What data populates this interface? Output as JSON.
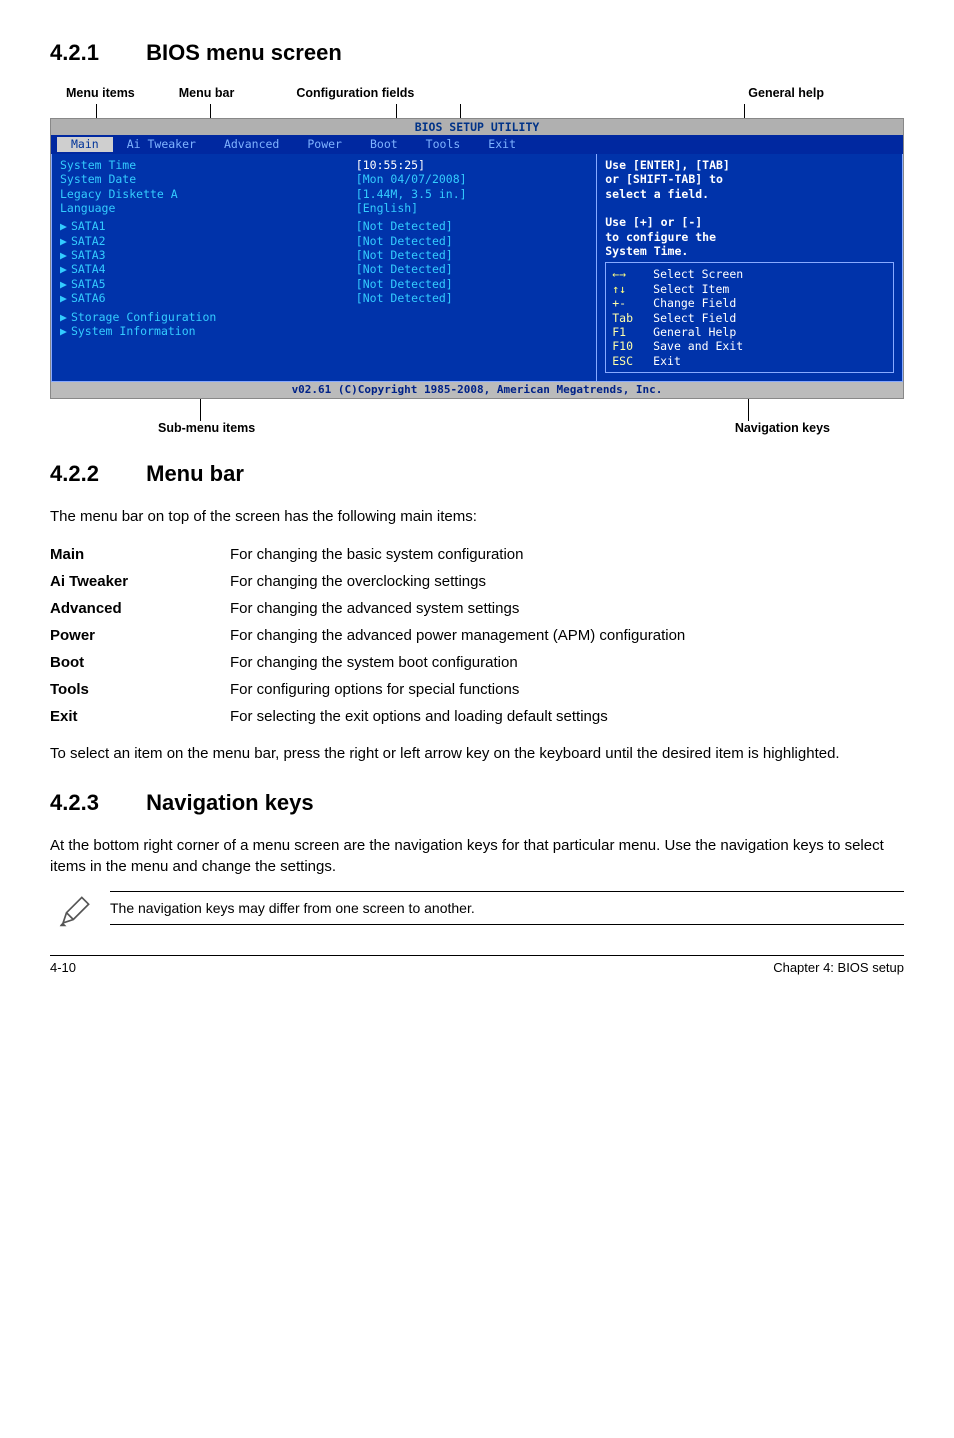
{
  "sections": {
    "s1": {
      "num": "4.2.1",
      "title": "BIOS menu screen"
    },
    "s2": {
      "num": "4.2.2",
      "title": "Menu bar"
    },
    "s3": {
      "num": "4.2.3",
      "title": "Navigation keys"
    }
  },
  "top_labels": {
    "menu_items": "Menu items",
    "menu_bar": "Menu bar",
    "config_fields": "Configuration fields",
    "general_help": "General help"
  },
  "bottom_labels": {
    "sub_menu": "Sub-menu items",
    "nav_keys": "Navigation keys"
  },
  "bios": {
    "title": "BIOS SETUP UTILITY",
    "tabs": [
      "Main",
      "Ai Tweaker",
      "Advanced",
      "Power",
      "Boot",
      "Tools",
      "Exit"
    ],
    "left": [
      {
        "k": "System Time",
        "v": "[10:55:25]",
        "sel": true
      },
      {
        "k": "System Date",
        "v": "[Mon 04/07/2008]"
      },
      {
        "k": "Legacy Diskette A",
        "v": "[1.44M, 3.5 in.]"
      },
      {
        "k": "Language",
        "v": "[English]"
      }
    ],
    "sata": [
      {
        "k": "SATA1",
        "v": "[Not Detected]"
      },
      {
        "k": "SATA2",
        "v": "[Not Detected]"
      },
      {
        "k": "SATA3",
        "v": "[Not Detected]"
      },
      {
        "k": "SATA4",
        "v": "[Not Detected]"
      },
      {
        "k": "SATA5",
        "v": "[Not Detected]"
      },
      {
        "k": "SATA6",
        "v": "[Not Detected]"
      }
    ],
    "submenu": [
      "Storage Configuration",
      "System Information"
    ],
    "help": "Use [ENTER], [TAB]\nor [SHIFT-TAB] to\nselect a field.\n\nUse [+] or [-]\nto configure the\nSystem Time.",
    "nav": [
      {
        "key": "←→",
        "txt": "Select Screen"
      },
      {
        "key": "↑↓",
        "txt": "Select Item"
      },
      {
        "key": "+-",
        "txt": "Change Field"
      },
      {
        "key": "Tab",
        "txt": "Select Field"
      },
      {
        "key": "F1",
        "txt": "General Help"
      },
      {
        "key": "F10",
        "txt": "Save and Exit"
      },
      {
        "key": "ESC",
        "txt": "Exit"
      }
    ],
    "footer": "v02.61 (C)Copyright 1985-2008, American Megatrends, Inc."
  },
  "menubar_intro": "The menu bar on top of the screen has the following main items:",
  "defs": [
    {
      "k": "Main",
      "v": "For changing the basic system configuration"
    },
    {
      "k": "Ai Tweaker",
      "v": "For changing the overclocking settings"
    },
    {
      "k": "Advanced",
      "v": "For changing the advanced system settings"
    },
    {
      "k": "Power",
      "v": "For changing the advanced power management (APM) configuration"
    },
    {
      "k": "Boot",
      "v": "For changing the system boot configuration"
    },
    {
      "k": "Tools",
      "v": "For configuring options for special functions"
    },
    {
      "k": "Exit",
      "v": "For selecting the exit options and loading default settings"
    }
  ],
  "menubar_outro": "To select an item on the menu bar, press the right or left arrow key on the keyboard until the desired item is highlighted.",
  "navkeys_text": "At the bottom right corner of a menu screen are the navigation keys for that particular menu. Use the navigation keys to select items in the menu and change the settings.",
  "note": "The navigation keys may differ from one screen to another.",
  "footer": {
    "left": "4-10",
    "right": "Chapter 4: BIOS setup"
  }
}
